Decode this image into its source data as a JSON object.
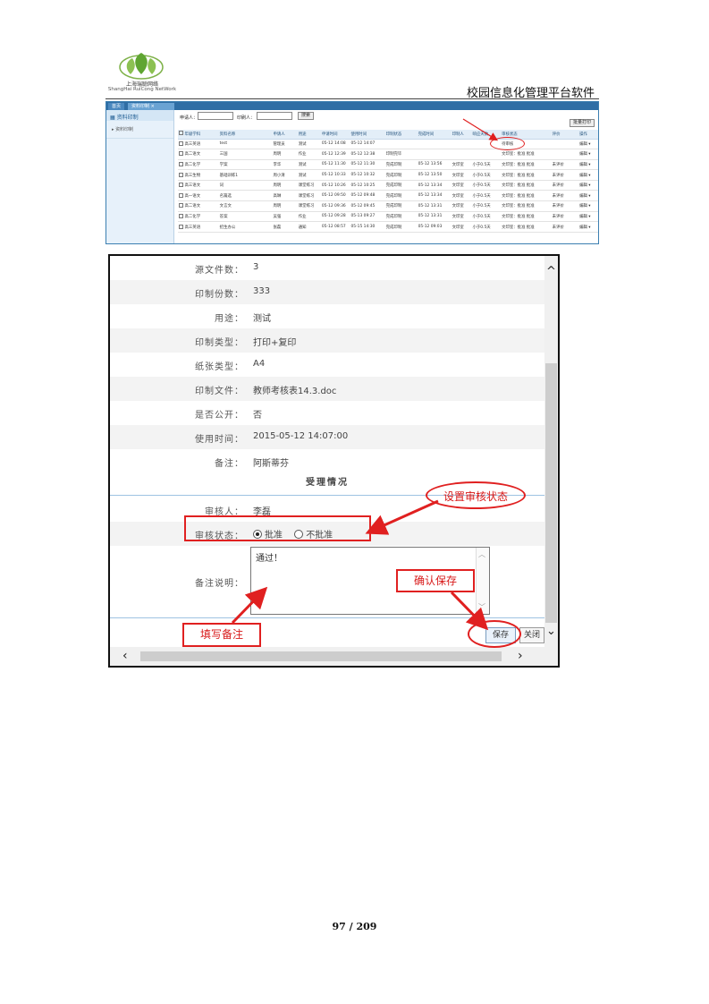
{
  "header": {
    "logo_cn": "上海瑞聪网络",
    "logo_en": "ShangHai RuiCong NetWork",
    "doc_title": "校园信息化管理平台软件"
  },
  "list_screen": {
    "tabs": [
      "首页",
      "资料印制"
    ],
    "sidebar": {
      "title": "资料印制",
      "item": "资料印制"
    },
    "search": {
      "applicant_label": "申请人：",
      "printer_label": "印刷人：",
      "button": "搜索"
    },
    "export_button": "批量打印",
    "columns": [
      "",
      "年级学科",
      "资料名称",
      "申请人",
      "用途",
      "申请时间",
      "使用时间",
      "印制状态",
      "完成时间",
      "印制人",
      "响应天数",
      "审核状态",
      "评价",
      "操作"
    ],
    "rows": [
      [
        "高三英语",
        "test",
        "管理员",
        "测试",
        "05-12 14:08",
        "05-12 14:07",
        "",
        "",
        "",
        "",
        "待审核",
        "",
        "编辑"
      ],
      [
        "高二语文",
        "三国",
        "周明",
        "作业",
        "05-12 12:39",
        "05-12 12:38",
        "印制完毕",
        "",
        "",
        "",
        "文印室：批准  批准",
        "",
        "编辑"
      ],
      [
        "高二化学",
        "学案",
        "李华",
        "测试",
        "05-12 11:30",
        "05-12 11:30",
        "完成印制",
        "05-12 13:56",
        "文印室",
        "小于0.5天",
        "文印室：批准  批准",
        "未评价",
        "编辑"
      ],
      [
        "高三生物",
        "基础训练1",
        "周小清",
        "测试",
        "05-12 10:33",
        "05-12 10:32",
        "完成印制",
        "05-12 13:50",
        "文印室",
        "小于0.5天",
        "文印室：批准  批准",
        "未评价",
        "编辑"
      ],
      [
        "高三语文",
        "词",
        "周明",
        "课堂练习",
        "05-12 10:26",
        "05-12 10:25",
        "完成印制",
        "05-12 13:34",
        "文印室",
        "小于0.5天",
        "文印室：批准  批准",
        "未评价",
        "编辑"
      ],
      [
        "高一语文",
        "名篇选",
        "高琳",
        "课堂练习",
        "05-12 09:50",
        "05-12 09:48",
        "完成印制",
        "05-12 13:34",
        "文印室",
        "小于0.5天",
        "文印室：批准  批准",
        "未评价",
        "编辑"
      ],
      [
        "高二语文",
        "文言文",
        "周明",
        "课堂练习",
        "05-12 09:36",
        "05-12 09:45",
        "完成印制",
        "05-12 13:31",
        "文印室",
        "小于0.5天",
        "文印室：批准  批准",
        "未评价",
        "编辑"
      ],
      [
        "高二化学",
        "答案",
        "吴强",
        "作业",
        "05-12 09:28",
        "05-13 09:27",
        "完成印制",
        "05-12 13:31",
        "文印室",
        "小于0.5天",
        "文印室：批准  批准",
        "未评价",
        "编辑"
      ],
      [
        "高三英语",
        "招生办公",
        "张磊",
        "通知",
        "05-12 08:57",
        "05-15 14:30",
        "完成印制",
        "05-12 09:03",
        "文印室",
        "小于0.5天",
        "文印室：批准  批准",
        "未评价",
        "编辑"
      ]
    ]
  },
  "detail_screen": {
    "fields": [
      {
        "label": "源文件数：",
        "value": "3"
      },
      {
        "label": "印制份数：",
        "value": "333"
      },
      {
        "label": "用途：",
        "value": "测试"
      },
      {
        "label": "印制类型：",
        "value": "打印+复印"
      },
      {
        "label": "纸张类型：",
        "value": "A4"
      },
      {
        "label": "印制文件：",
        "value": "教师考核表14.3.doc"
      },
      {
        "label": "是否公开：",
        "value": "否"
      },
      {
        "label": "使用时间：",
        "value": "2015-05-12 14:07:00"
      },
      {
        "label": "备注：",
        "value": "阿斯蒂芬"
      }
    ],
    "section_title": "受理情况",
    "reviewer_label": "审核人：",
    "reviewer_value": "李磊",
    "status_label": "审核状态：",
    "status_options": [
      "批准",
      "不批准"
    ],
    "status_selected": "批准",
    "note_label": "备注说明：",
    "note_value": "通过！",
    "save_button": "保存",
    "close_button": "关闭"
  },
  "annotations": {
    "set_status": "设置审核状态",
    "confirm_save": "确认保存",
    "fill_note": "填写备注"
  },
  "colors": {
    "annotation": "#e02020",
    "tab_bar": "#2f6ea5"
  },
  "page_number": "97 / 209"
}
